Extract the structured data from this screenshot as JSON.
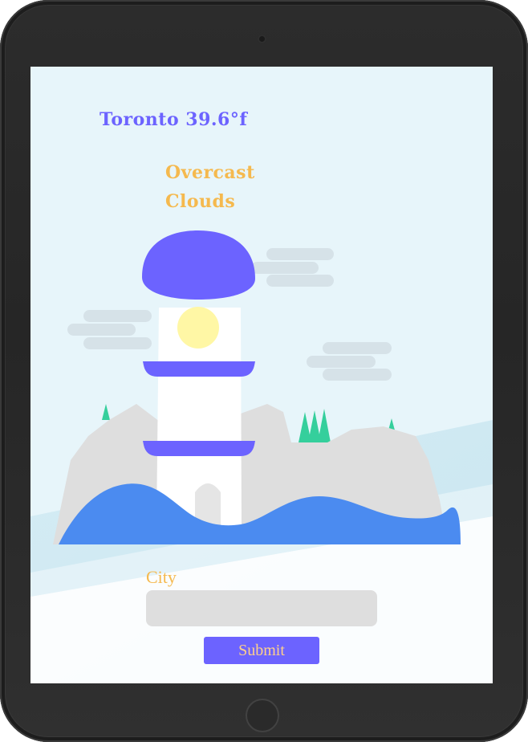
{
  "weather": {
    "title": "Toronto 39.6°f",
    "description": "Overcast Clouds"
  },
  "form": {
    "city_label": "City",
    "city_value": "",
    "city_placeholder": "",
    "submit_label": "Submit"
  },
  "colors": {
    "accent": "#6c63ff",
    "highlight": "#f5b94e",
    "screen_background": "#e7f5fa",
    "sea": "#4b8bf0",
    "rocks": "#dedede",
    "trees": "#35cf9c",
    "sun": "#fff7a5",
    "clouds": "#d6e2e8",
    "device_frame": "#262626"
  },
  "illustration": {
    "subject": "lighthouse-on-rocks-by-sea"
  }
}
